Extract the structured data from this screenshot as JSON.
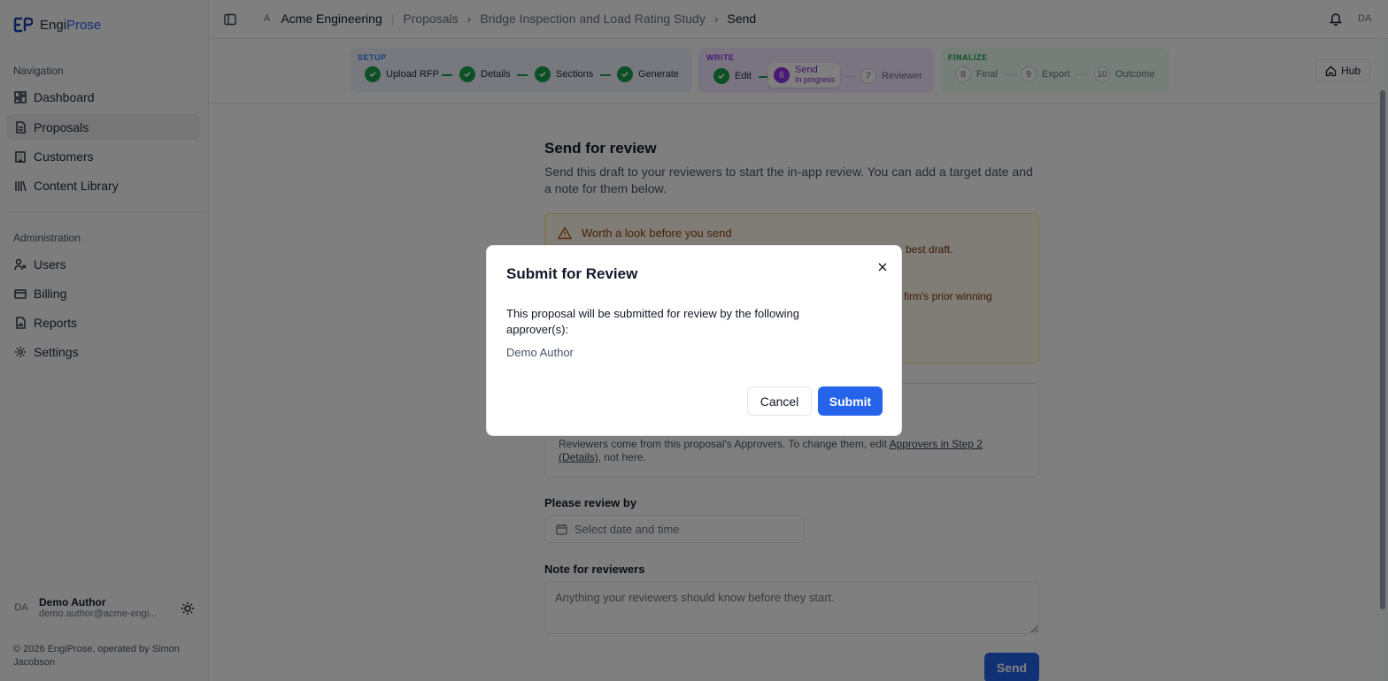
{
  "brand": {
    "part1": "Engi",
    "part2": "Prose"
  },
  "sidebar": {
    "nav_heading": "Navigation",
    "nav_items": [
      {
        "label": "Dashboard",
        "icon": "dashboard-icon"
      },
      {
        "label": "Proposals",
        "icon": "document-icon",
        "active": true
      },
      {
        "label": "Customers",
        "icon": "building-icon"
      },
      {
        "label": "Content Library",
        "icon": "library-icon"
      }
    ],
    "admin_heading": "Administration",
    "admin_items": [
      {
        "label": "Users",
        "icon": "users-icon"
      },
      {
        "label": "Billing",
        "icon": "card-icon"
      },
      {
        "label": "Reports",
        "icon": "report-icon"
      },
      {
        "label": "Settings",
        "icon": "gear-icon"
      }
    ],
    "user": {
      "initials": "DA",
      "name": "Demo Author",
      "email": "demo.author@acme-engi..."
    },
    "copyright": "© 2026 EngiProse, operated by Simon Jacobson"
  },
  "header": {
    "org_initial": "A",
    "org_name": "Acme Engineering",
    "breadcrumb": [
      "Proposals",
      "Bridge Inspection and Load Rating Study",
      "Send"
    ],
    "avatar": "DA"
  },
  "steps": {
    "groups": [
      {
        "label": "SETUP",
        "color": "#3b82f6"
      },
      {
        "label": "WRITE",
        "color": "#9333ea"
      },
      {
        "label": "FINALIZE",
        "color": "#16a34a"
      }
    ],
    "items": [
      {
        "label": "Upload RFP",
        "state": "done"
      },
      {
        "label": "Details",
        "state": "done"
      },
      {
        "label": "Sections",
        "state": "done"
      },
      {
        "label": "Generate",
        "state": "done"
      },
      {
        "label": "Edit",
        "state": "done"
      },
      {
        "num": "6",
        "label": "Send",
        "sub": "In progress",
        "state": "current"
      },
      {
        "num": "7",
        "label": "Reviewer",
        "state": "todo"
      },
      {
        "num": "8",
        "label": "Final",
        "state": "todo"
      },
      {
        "num": "9",
        "label": "Export",
        "state": "todo"
      },
      {
        "num": "10",
        "label": "Outcome",
        "state": "todo"
      }
    ],
    "hub_label": "Hub"
  },
  "main": {
    "title": "Send for review",
    "description": "Send this draft to your reviewers to start the in-app review. You can add a target date and a note for them below.",
    "warning": {
      "title": "Worth a look before you send",
      "line1_fragment": "best draft.",
      "line2_fragment": "firm's prior winning"
    },
    "reviewers_note_prefix": "Reviewers come from this proposal's Approvers. To change them, edit ",
    "reviewers_note_link": "Approvers in Step 2 (Details)",
    "reviewers_note_suffix": ", not here.",
    "review_by_label": "Please review by",
    "date_placeholder": "Select date and time",
    "note_label": "Note for reviewers",
    "note_placeholder": "Anything your reviewers should know before they start.",
    "send_label": "Send"
  },
  "modal": {
    "title": "Submit for Review",
    "body": "This proposal will be submitted for review by the following approver(s):",
    "approver": "Demo Author",
    "cancel_label": "Cancel",
    "submit_label": "Submit"
  }
}
